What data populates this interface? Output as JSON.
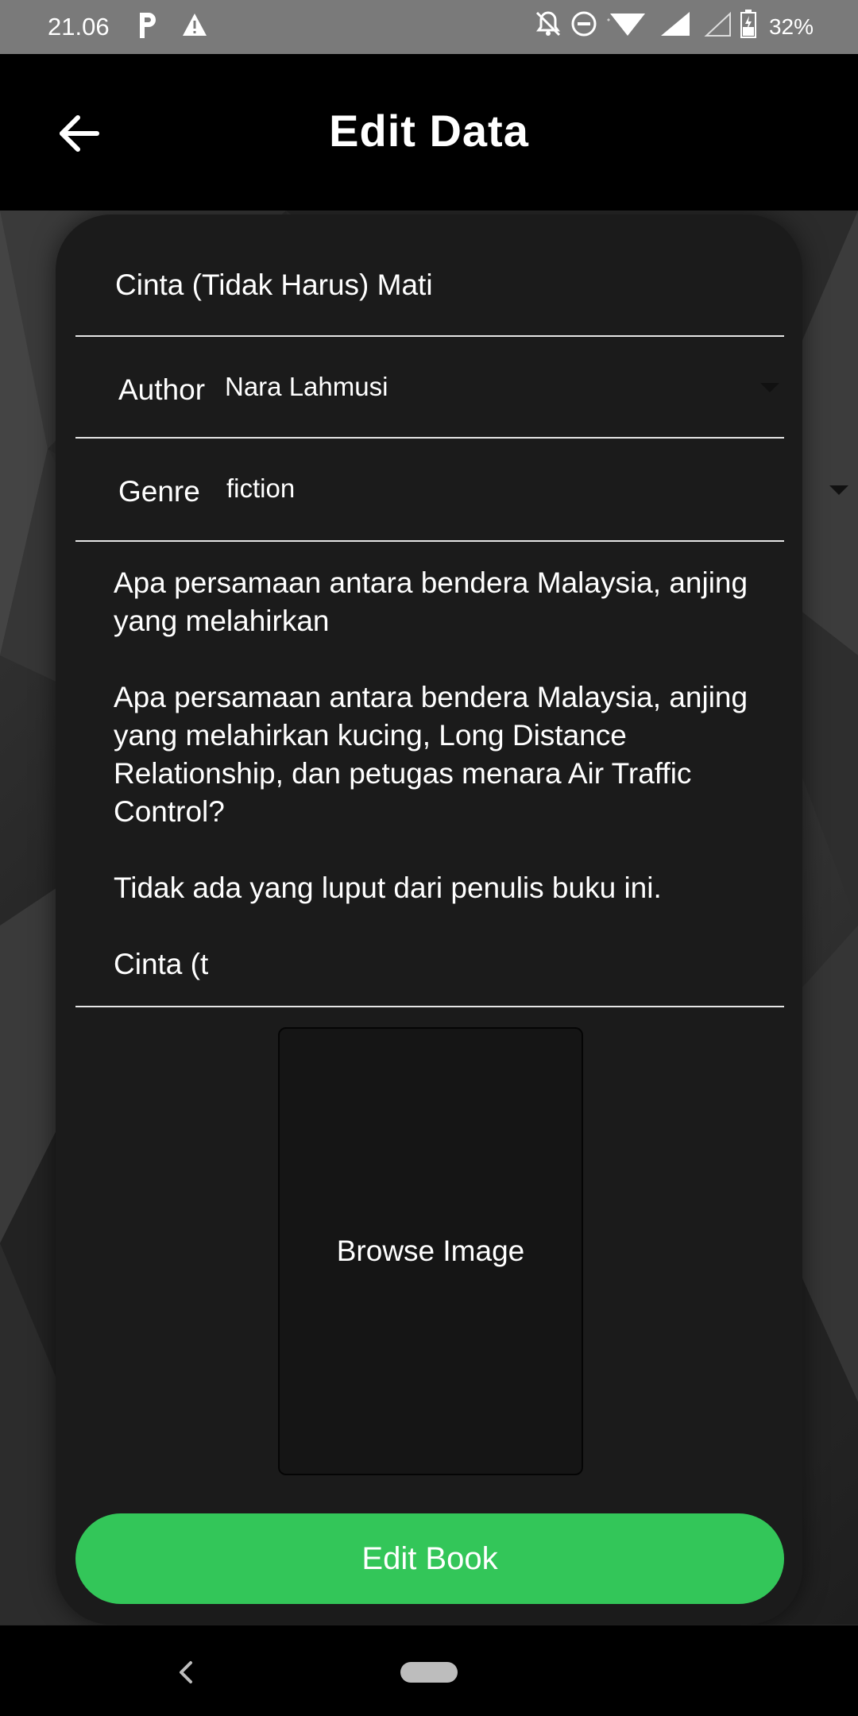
{
  "status_bar": {
    "time": "21.06",
    "battery": "32%",
    "icons": [
      "parking-icon",
      "warning-icon",
      "bell-off-icon",
      "do-not-disturb-icon",
      "wifi-icon",
      "signal-icon",
      "signal-empty-icon",
      "battery-icon"
    ]
  },
  "app_bar": {
    "title": "Edit Data",
    "back_icon": "arrow-left-icon"
  },
  "form": {
    "title_value": "Cinta (Tidak Harus) Mati",
    "author_label": "Author",
    "author_value": "Nara Lahmusi",
    "genre_label": "Genre",
    "genre_value": "fiction",
    "description_value": "Apa persamaan antara bendera Malaysia, anjing yang melahirkan\n\nApa persamaan antara bendera Malaysia, anjing yang melahirkan kucing, Long Distance Relationship, dan petugas menara Air Traffic Control?\n\nTidak ada yang luput dari penulis buku ini.\n\nCinta (t",
    "browse_image_label": "Browse Image",
    "submit_label": "Edit Book"
  },
  "colors": {
    "accent": "#33c659",
    "app_bar": "#000000",
    "status_bar": "#7a7a7a"
  }
}
